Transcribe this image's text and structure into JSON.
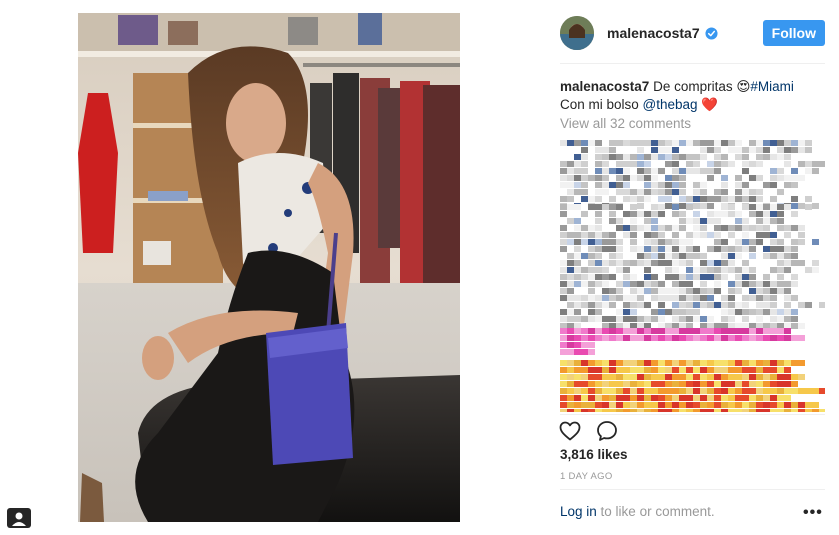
{
  "post": {
    "username": "malenacosta7",
    "follow_label": "Follow",
    "caption_user": "malenacosta7",
    "caption_text": " De compritas 😍",
    "caption_hashtag": "#Miami",
    "caption_line2": "Con mi bolso ",
    "caption_mention": "@thebag",
    "caption_heart": " ❤️",
    "view_all_comments": "View all 32 comments",
    "likes": "3,816 likes",
    "timestamp": "1 DAY AGO",
    "login_link": "Log in",
    "login_rest": " to like or comment.",
    "more_label": "•••"
  },
  "icons": {
    "verified": "verified-badge-icon",
    "like": "heart-outline-icon",
    "comment": "speech-bubble-icon",
    "user_tag": "user-tag-icon",
    "more": "ellipsis-icon"
  },
  "colors": {
    "follow_button": "#3897f0",
    "link": "#003569",
    "muted": "#999999",
    "verified": "#3897f0"
  }
}
